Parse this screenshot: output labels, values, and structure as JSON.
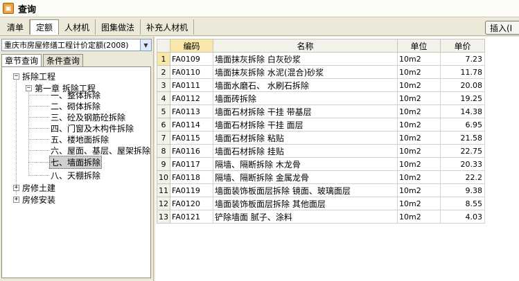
{
  "window": {
    "title": "查询"
  },
  "main_tabs": [
    "清单",
    "定额",
    "人材机",
    "图集做法",
    "补充人材机"
  ],
  "insert_button": "插入(I",
  "quota_select": {
    "value": "重庆市房屋修缮工程计价定额(2008)"
  },
  "sub_tabs": [
    "章节查询",
    "条件查询"
  ],
  "tree": {
    "root": "拆除工程",
    "chapter": "第一章 拆除工程",
    "sections": [
      "一、整体拆除",
      "二、砌体拆除",
      "三、砼及钢筋砼拆除",
      "四、门窗及木构件拆除",
      "五、楼地面拆除",
      "六、屋面、基层、屋架拆除",
      "七、墙面拆除",
      "八、天棚拆除"
    ],
    "selected": "七、墙面拆除",
    "other_roots": [
      "房修土建",
      "房修安装"
    ]
  },
  "grid": {
    "columns": [
      "",
      "编码",
      "名称",
      "单位",
      "单价"
    ],
    "rows": [
      {
        "n": "1",
        "code": "FA0109",
        "name": "墙面抹灰拆除 白灰砂浆",
        "unit": "10m2",
        "price": "7.23"
      },
      {
        "n": "2",
        "code": "FA0110",
        "name": "墙面抹灰拆除 水泥(混合)砂浆",
        "unit": "10m2",
        "price": "11.78"
      },
      {
        "n": "3",
        "code": "FA0111",
        "name": "墙面水磨石、 水刷石拆除",
        "unit": "10m2",
        "price": "20.08"
      },
      {
        "n": "4",
        "code": "FA0112",
        "name": "墙面砖拆除",
        "unit": "10m2",
        "price": "19.25"
      },
      {
        "n": "5",
        "code": "FA0113",
        "name": "墙面石材拆除 干挂 带基层",
        "unit": "10m2",
        "price": "14.38"
      },
      {
        "n": "6",
        "code": "FA0114",
        "name": "墙面石材拆除 干挂 面层",
        "unit": "10m2",
        "price": "6.95"
      },
      {
        "n": "7",
        "code": "FA0115",
        "name": "墙面石材拆除 粘贴",
        "unit": "10m2",
        "price": "21.58"
      },
      {
        "n": "8",
        "code": "FA0116",
        "name": "墙面石材拆除 挂贴",
        "unit": "10m2",
        "price": "22.75"
      },
      {
        "n": "9",
        "code": "FA0117",
        "name": "隔墙、隔断拆除 木龙骨",
        "unit": "10m2",
        "price": "20.33"
      },
      {
        "n": "10",
        "code": "FA0118",
        "name": "隔墙、隔断拆除 金属龙骨",
        "unit": "10m2",
        "price": "22.2"
      },
      {
        "n": "11",
        "code": "FA0119",
        "name": "墙面装饰板面层拆除 镜面、玻璃面层",
        "unit": "10m2",
        "price": "9.38"
      },
      {
        "n": "12",
        "code": "FA0120",
        "name": "墙面装饰板面层拆除 其他面层",
        "unit": "10m2",
        "price": "8.55"
      },
      {
        "n": "13",
        "code": "FA0121",
        "name": "铲除墙面 腻子、涂料",
        "unit": "10m2",
        "price": "4.03"
      }
    ]
  },
  "colors": {
    "selected_header": "#f8e7a8",
    "window_bg": "#ece9d8"
  }
}
